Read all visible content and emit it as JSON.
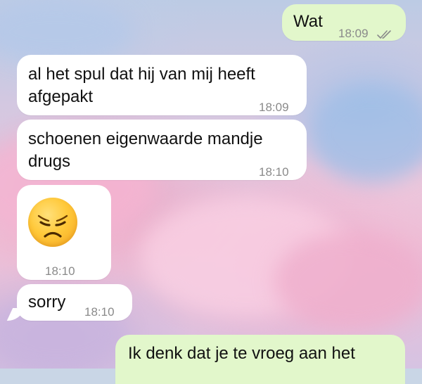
{
  "messages": [
    {
      "direction": "outgoing",
      "text": "Wat",
      "time": "18:09",
      "status": "read-ticks-icon"
    },
    {
      "direction": "incoming",
      "lines": [
        "al het spul dat hij van mij heeft",
        "afgepakt"
      ],
      "time": "18:09"
    },
    {
      "direction": "incoming",
      "lines": [
        "schoenen eigenwaarde mandje",
        "drugs"
      ],
      "time": "18:10"
    },
    {
      "direction": "incoming",
      "emoji": "disappointed-face-icon",
      "time": "18:10"
    },
    {
      "direction": "incoming",
      "text": "sorry",
      "time": "18:10"
    },
    {
      "direction": "outgoing",
      "text": "Ik denk dat je te vroeg aan het"
    }
  ],
  "colors": {
    "incoming_bubble": "#ffffff",
    "outgoing_bubble": "#e2f7cb",
    "timestamp": "#8a8a8a",
    "read_ticks": "#8a8a8a"
  }
}
